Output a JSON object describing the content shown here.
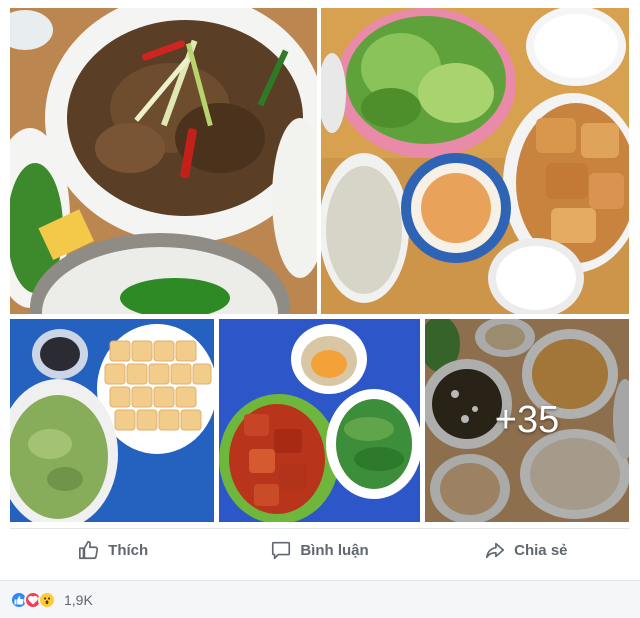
{
  "photos": {
    "more_count": "+35"
  },
  "actions": {
    "like_label": "Thích",
    "comment_label": "Bình luận",
    "share_label": "Chia sẻ"
  },
  "reactions": {
    "icons": [
      "like-icon",
      "love-icon",
      "wow-icon"
    ],
    "count": "1,9K"
  },
  "colors": {
    "action_text": "#606770",
    "like_blue": "#2d88ff",
    "love_red": "#f33e58",
    "wow_yellow": "#fccd36"
  }
}
